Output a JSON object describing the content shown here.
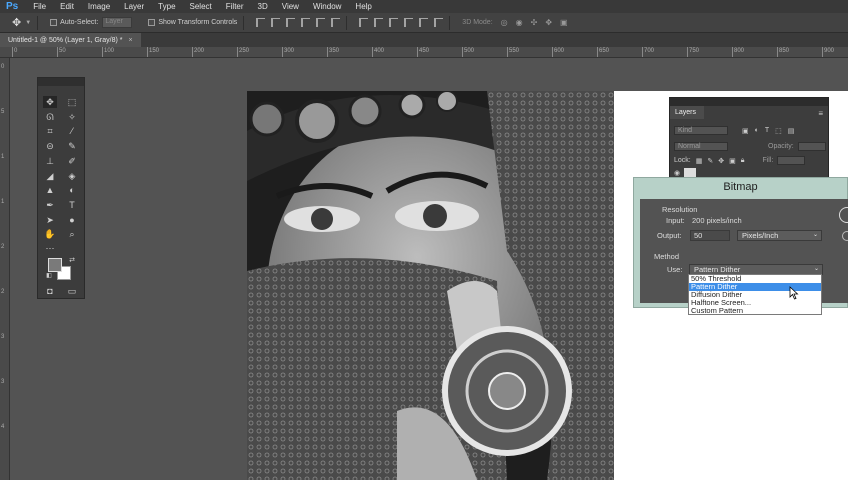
{
  "app": {
    "logo": "Ps",
    "menus": [
      "File",
      "Edit",
      "Image",
      "Layer",
      "Type",
      "Select",
      "Filter",
      "3D",
      "View",
      "Window",
      "Help"
    ]
  },
  "options_bar": {
    "auto_select_label": "Auto-Select:",
    "auto_select_value": "Layer",
    "show_transform_label": "Show Transform Controls",
    "mode_3d_label": "3D Mode:"
  },
  "document": {
    "tab_title": "Untitled-1 @ 50% (Layer 1, Gray/8) *"
  },
  "ruler": {
    "top_ticks": [
      "0",
      "50",
      "100",
      "150",
      "200",
      "250",
      "300",
      "350",
      "400",
      "450",
      "500",
      "550",
      "600",
      "650",
      "700",
      "750",
      "800",
      "850",
      "900"
    ],
    "left_ticks": [
      "0",
      "5",
      "1",
      "1",
      "2",
      "2",
      "3",
      "3",
      "4"
    ]
  },
  "layers_panel": {
    "tab": "Layers",
    "kind_placeholder": "Kind",
    "blend_mode": "Normal",
    "opacity_label": "Opacity:",
    "lock_label": "Lock:",
    "fill_label": "Fill:"
  },
  "bitmap_dialog": {
    "title": "Bitmap",
    "resolution_label": "Resolution",
    "input_label": "Input:",
    "input_value": "200 pixels/inch",
    "output_label": "Output:",
    "output_value": "50",
    "output_unit": "Pixels/Inch",
    "method_label": "Method",
    "use_label": "Use:",
    "use_value": "Pattern Dither",
    "options": [
      "50% Threshold",
      "Pattern Dither",
      "Diffusion Dither",
      "Halftone Screen...",
      "Custom Pattern"
    ],
    "selected_index": 1
  },
  "colors": {
    "foreground": "#7a7a7a",
    "background": "#ffffff",
    "dialog_bg": "#b7d1c8",
    "highlight": "#3d8ee8"
  }
}
